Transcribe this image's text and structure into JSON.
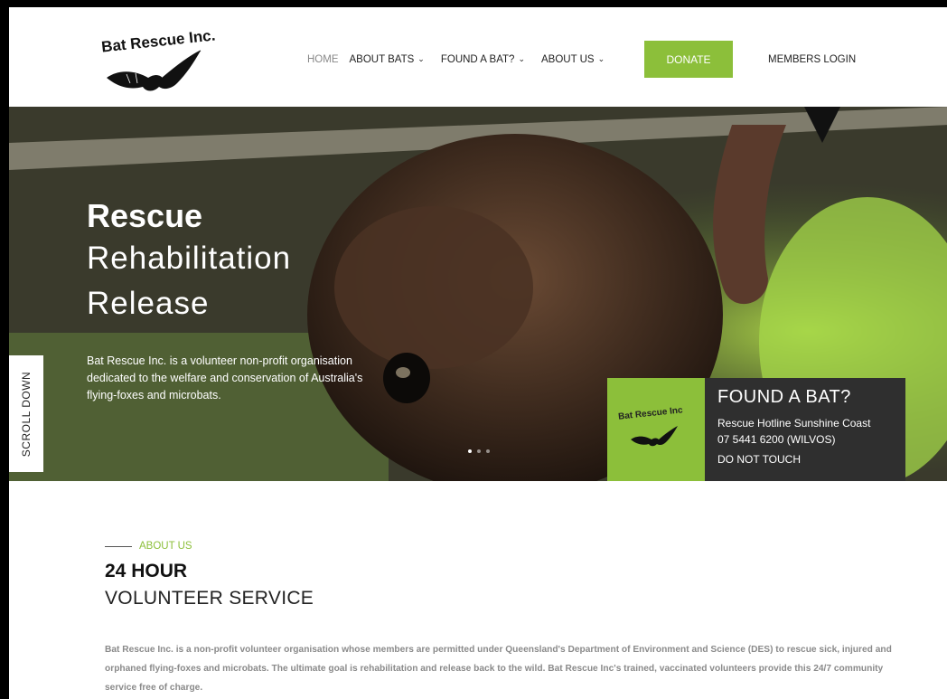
{
  "header": {
    "logo_text": "Bat Rescue Inc.",
    "nav": [
      {
        "label": "HOME",
        "dropdown": false,
        "active": true
      },
      {
        "label": "ABOUT BATS",
        "dropdown": true
      },
      {
        "label": "FOUND A BAT?",
        "dropdown": true
      },
      {
        "label": "ABOUT US",
        "dropdown": true
      }
    ],
    "donate_label": "DONATE",
    "members_label": "MEMBERS LOGIN"
  },
  "hero": {
    "title_strong": "Rescue",
    "title_line1": "Rehabilitation",
    "title_line2": "Release",
    "description": "Bat Rescue Inc. is a volunteer non-profit organisation dedicated to the welfare and conservation of Australia's flying-foxes and microbats.",
    "scroll_label": "SCROLL DOWN",
    "slides": 3,
    "active_slide": 0
  },
  "found_box": {
    "logo_text": "Bat Rescue Inc",
    "title": "FOUND A BAT?",
    "line1": "Rescue Hotline Sunshine Coast",
    "line2": "07 5441 6200 (WILVOS)",
    "line3": "DO NOT TOUCH"
  },
  "about": {
    "label": "ABOUT US",
    "heading_bold": "24 HOUR",
    "heading_light": "VOLUNTEER SERVICE",
    "body": "Bat Rescue Inc. is a non-profit volunteer organisation whose members are permitted under Queensland's Department of Environment and Science (DES) to rescue sick, injured and orphaned flying-foxes and microbats. The ultimate goal is rehabilitation and release back to the wild. Bat Rescue Inc's trained, vaccinated volunteers provide this 24/7 community service free of charge."
  },
  "colors": {
    "accent_green": "#8cbf3a",
    "dark_panel": "#2f2f2f",
    "text_dark": "#222222",
    "muted_text": "#8a8a8a"
  },
  "icons": {
    "dropdown": "chevron-down-icon",
    "logo_bat": "bat-logo-icon"
  }
}
